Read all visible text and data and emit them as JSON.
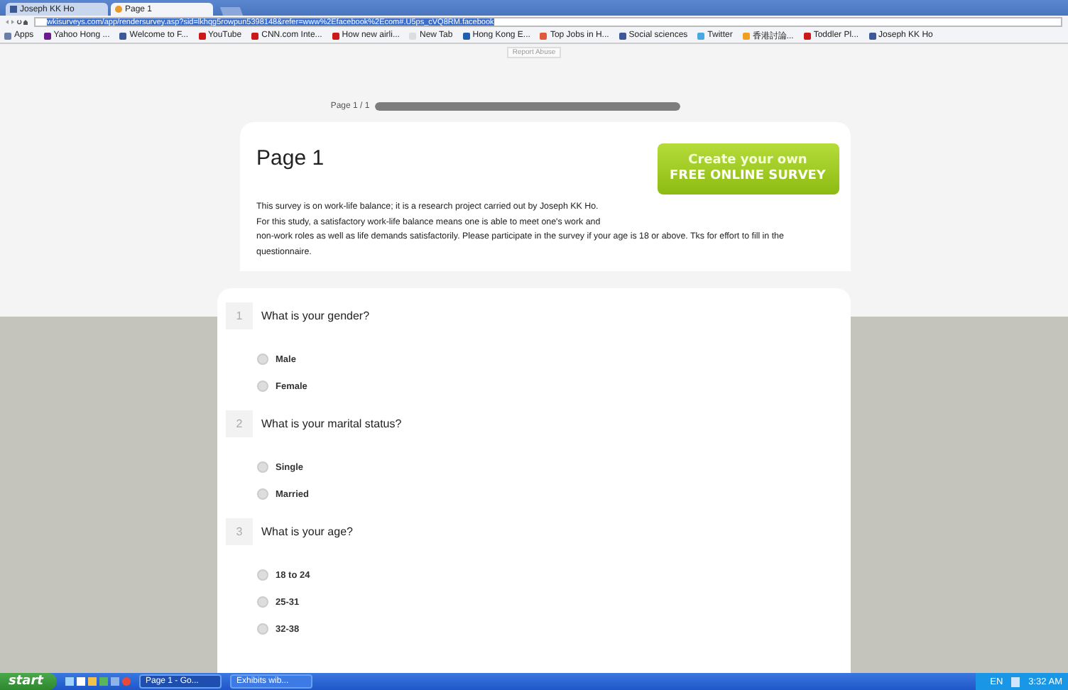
{
  "tabs": [
    {
      "label": "Joseph KK Ho",
      "selected": false
    },
    {
      "label": "Page 1",
      "selected": true
    }
  ],
  "address": {
    "url": "wkisurveys.com/app/rendersurvey.asp?sid=lkhqg5rowpun5398148&refer=www%2Efacebook%2Ecom#.U5ps_cVQ8RM.facebook"
  },
  "bookmarks": [
    {
      "label": "Apps",
      "color": "#6a7fa8"
    },
    {
      "label": "Yahoo Hong ...",
      "color": "#6b1b8f"
    },
    {
      "label": "Welcome to F...",
      "color": "#3b5998"
    },
    {
      "label": "YouTube",
      "color": "#cc1818"
    },
    {
      "label": "CNN.com Inte...",
      "color": "#cc1818"
    },
    {
      "label": "How new airli...",
      "color": "#cc1818"
    },
    {
      "label": "New Tab",
      "color": "#dddddd"
    },
    {
      "label": "Hong Kong E...",
      "color": "#1f5fae"
    },
    {
      "label": "Top Jobs in H...",
      "color": "#e05a3a"
    },
    {
      "label": "Social sciences",
      "color": "#3b5998"
    },
    {
      "label": "Twitter",
      "color": "#4aa8e0"
    },
    {
      "label": "香港討論...",
      "color": "#f0a020"
    },
    {
      "label": "Toddler Pl...",
      "color": "#cc1818"
    },
    {
      "label": "Joseph KK Ho",
      "color": "#3b5998"
    }
  ],
  "report_abuse": "Report Abuse",
  "progress": {
    "label": "Page 1 / 1",
    "level": 1
  },
  "intro": {
    "title": "Page 1",
    "cta_line1": "Create your own",
    "cta_line2": "FREE ONLINE SURVEY",
    "lines": [
      "This survey is on work-life balance; it is a research project carried out by Joseph KK Ho.",
      "For this study, a satisfactory work-life balance means one is able to meet one's work and",
      "non-work roles as well as life demands satisfactorily. Please participate in the survey if your age is 18 or above. Tks for effort to fill in the questionnaire."
    ]
  },
  "questions": [
    {
      "number": "1",
      "text": "What is your gender?",
      "options": [
        {
          "label": "Male",
          "selected": false
        },
        {
          "label": "Female",
          "selected": false
        }
      ]
    },
    {
      "number": "2",
      "text": "What is your marital status?",
      "options": [
        {
          "label": "Single",
          "selected": false
        },
        {
          "label": "Married",
          "selected": false
        }
      ]
    },
    {
      "number": "3",
      "text": "What is your age?",
      "options": [
        {
          "label": "18 to 24",
          "selected": false
        },
        {
          "label": "25-31",
          "selected": false
        },
        {
          "label": "32-38",
          "selected": false
        }
      ]
    }
  ],
  "taskbar": {
    "start": "start",
    "windows": [
      {
        "label": "Page 1 - Go...",
        "selected": true
      },
      {
        "label": "Exhibits wib...",
        "selected": false
      }
    ],
    "language": "EN",
    "clock": "3:32 AM"
  }
}
